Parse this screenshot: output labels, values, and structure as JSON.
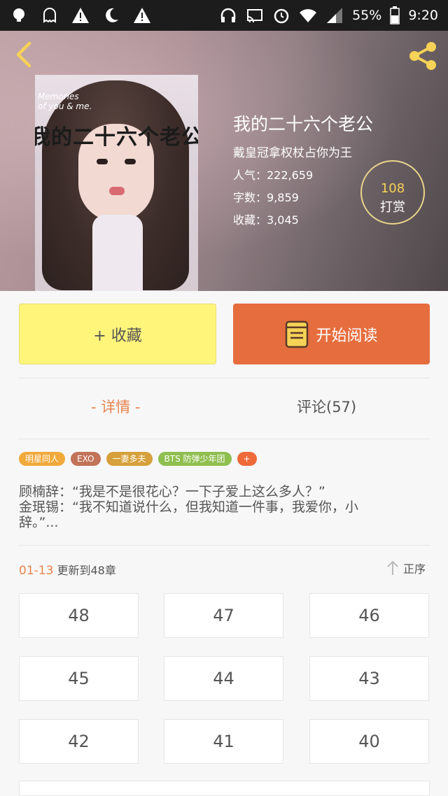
{
  "status_bar": {
    "battery": "55%",
    "time": "9:20",
    "left_icons": [
      "bulb-notification-icon",
      "ghost-notification-icon",
      "warning-icon",
      "moon-icon",
      "warning-icon"
    ],
    "right_icons": [
      "headphones-icon",
      "cast-icon",
      "alarm-icon",
      "wifi-icon",
      "signal-icon",
      "battery-icon"
    ]
  },
  "header": {
    "back_icon": "chevron-left-icon",
    "share_icon": "share-icon"
  },
  "cover": {
    "text": "我的二十六个老公",
    "deco": [
      "Memories",
      "of you & me."
    ]
  },
  "book": {
    "title": "我的二十六个老公",
    "author": "戴皇冠拿权杖占你为王",
    "popularity": "人气：222,659",
    "words": "字数：9,859",
    "favorites": "收藏：3,045"
  },
  "reward": {
    "count": "108",
    "label": "打赏"
  },
  "actions": {
    "collect_label": "+ 收藏",
    "read_label": "开始阅读"
  },
  "tabs": {
    "details": "- 详情 -",
    "comments": "评论(57)"
  },
  "tags": [
    {
      "label": "明星同人",
      "color": "#f2a93b"
    },
    {
      "label": "EXO",
      "color": "#c27358"
    },
    {
      "label": "一妻多夫",
      "color": "#d6a03a"
    },
    {
      "label": "BTS 防弹少年团",
      "color": "#8fbf4e"
    },
    {
      "label": "+",
      "color": "#ee6a3a"
    }
  ],
  "synopsis": {
    "line1": "顾楠辞：“我是不是很花心？一下子爱上这么多人？”",
    "line2": "金珉锡：“我不知道说什么，但我知道一件事，我爱你，小",
    "line3": "辞。”..."
  },
  "updates": {
    "date": "01-13",
    "text": "更新到48章",
    "sort_label": "正序"
  },
  "chapters": [
    "48",
    "47",
    "46",
    "45",
    "44",
    "43",
    "42",
    "41",
    "40"
  ],
  "colors": {
    "accent": "#e8834e",
    "read_button": "#e66d3d",
    "collect_button": "#fff57b",
    "icon_yellow": "#f6d256"
  }
}
